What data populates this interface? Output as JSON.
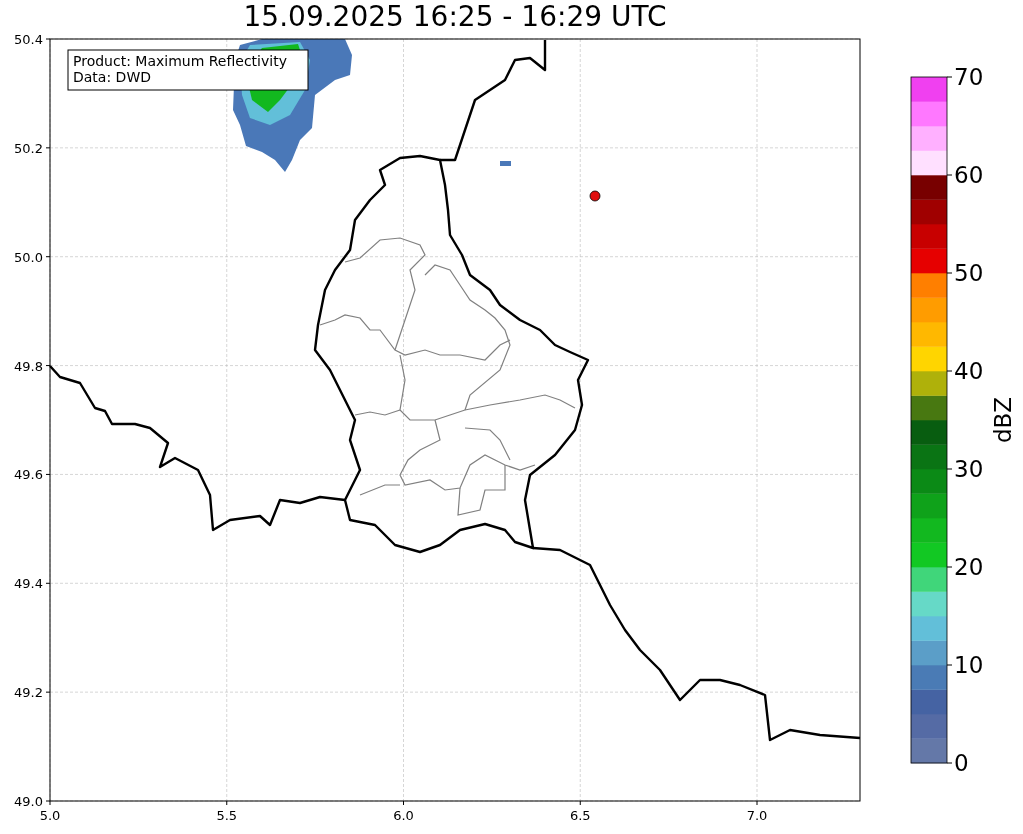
{
  "title": "15.09.2025 16:25 - 16:29 UTC",
  "info_box": {
    "lines": [
      "Product: Maximum Reflectivity",
      "Data: DWD"
    ]
  },
  "x_axis": {
    "ticks": [
      "5.0",
      "5.5",
      "6.0",
      "6.5",
      "7.0"
    ]
  },
  "y_axis": {
    "ticks": [
      "50.4",
      "50.2",
      "50.0",
      "49.8",
      "49.6",
      "49.4",
      "49.2",
      "49.0"
    ]
  },
  "colorbar": {
    "label": "dBZ",
    "ticks": [
      "70",
      "60",
      "50",
      "40",
      "30",
      "20",
      "10",
      "0"
    ],
    "segments": [
      {
        "color": "#6478a8"
      },
      {
        "color": "#556ba5"
      },
      {
        "color": "#4563a3"
      },
      {
        "color": "#4a7bb5"
      },
      {
        "color": "#5b9ec8"
      },
      {
        "color": "#62bfd9"
      },
      {
        "color": "#66d9c7"
      },
      {
        "color": "#40d67a"
      },
      {
        "color": "#12c823"
      },
      {
        "color": "#12b81f"
      },
      {
        "color": "#0fa21a"
      },
      {
        "color": "#0b8a16"
      },
      {
        "color": "#0a7414"
      },
      {
        "color": "#085d10"
      },
      {
        "color": "#487811"
      },
      {
        "color": "#afb10a"
      },
      {
        "color": "#ffd500"
      },
      {
        "color": "#ffb800"
      },
      {
        "color": "#ff9c00"
      },
      {
        "color": "#ff7f00"
      },
      {
        "color": "#e60000"
      },
      {
        "color": "#c80000"
      },
      {
        "color": "#a00000"
      },
      {
        "color": "#780000"
      },
      {
        "color": "#ffe0ff"
      },
      {
        "color": "#ffb0ff"
      },
      {
        "color": "#ff78ff"
      },
      {
        "color": "#f040f0"
      }
    ]
  }
}
